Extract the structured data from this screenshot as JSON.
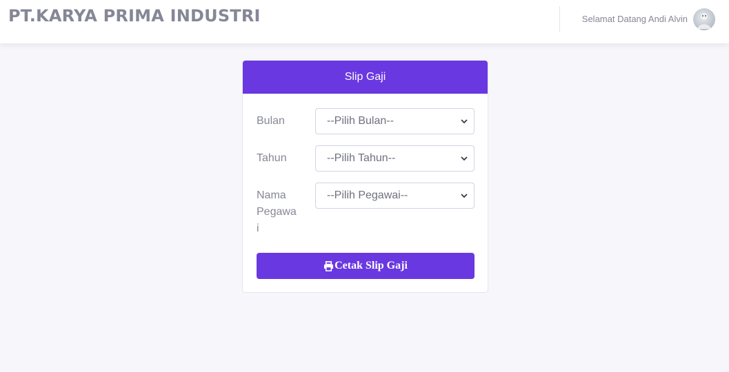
{
  "header": {
    "brand": "PT.KARYA PRIMA INDUSTRI",
    "welcome": "Selamat Datang Andi Alvin"
  },
  "card": {
    "title": "Slip Gaji",
    "fields": [
      {
        "label": "Bulan",
        "value": "--Pilih Bulan--"
      },
      {
        "label": "Tahun",
        "value": "--Pilih Tahun--"
      },
      {
        "label": "Nama Pegawai",
        "label_lines": [
          "Nama",
          "Pegawa",
          "i"
        ],
        "value": "--Pilih Pegawai--"
      }
    ],
    "button_label": "Cetak Slip Gaji",
    "button_icon": "print-icon"
  },
  "colors": {
    "primary": "#6a38e0",
    "text_muted": "#858796",
    "background": "#f6f6fb"
  }
}
